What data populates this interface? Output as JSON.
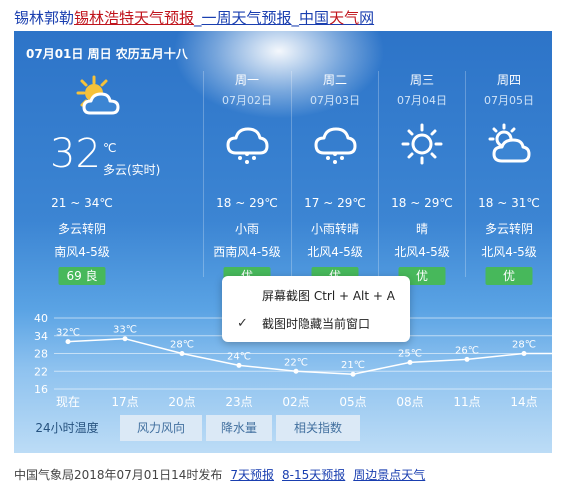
{
  "title": {
    "part1": "锡林郭勒",
    "part2": "锡林浩特天气预报",
    "sep1": "_",
    "part3": "一周天气预报",
    "sep2": "_",
    "part4a": "中国",
    "part4b": "天气",
    "part4c": "网"
  },
  "today": {
    "date_line": "07月01日 周日 农历五月十八",
    "temp": "32",
    "unit": "℃",
    "desc": "多云(实时)",
    "range": "21 ~ 34℃",
    "weather": "多云转阴",
    "wind": "南风4-5级",
    "aqi_label": "69  良",
    "icon": "partly-cloudy-day-icon"
  },
  "forecast": [
    {
      "day": "周一",
      "date": "07月02日",
      "range": "18 ~ 29℃",
      "weather": "小雨",
      "wind": "西南风4-5级",
      "aqi": "优",
      "icon": "rain-cloud-icon"
    },
    {
      "day": "周二",
      "date": "07月03日",
      "range": "17 ~ 29℃",
      "weather": "小雨转晴",
      "wind": "北风4-5级",
      "aqi": "优",
      "icon": "rain-cloud-icon"
    },
    {
      "day": "周三",
      "date": "07月04日",
      "range": "18 ~ 29℃",
      "weather": "晴",
      "wind": "北风4-5级",
      "aqi": "优",
      "icon": "sun-icon"
    },
    {
      "day": "周四",
      "date": "07月05日",
      "range": "18 ~ 31℃",
      "weather": "多云转阴",
      "wind": "北风4-5级",
      "aqi": "优",
      "icon": "partly-cloudy-day-icon"
    }
  ],
  "colors": {
    "aqi_good": "#47b85b",
    "chart_line": "#ffffff"
  },
  "chart_data": {
    "type": "line",
    "categories": [
      "现在",
      "17点",
      "20点",
      "23点",
      "02点",
      "05点",
      "08点",
      "11点",
      "14点"
    ],
    "values": [
      32,
      33,
      28,
      24,
      22,
      21,
      25,
      26,
      28
    ],
    "value_labels": [
      "32℃",
      "33℃",
      "28℃",
      "24℃",
      "22℃",
      "21℃",
      "25℃",
      "26℃",
      "28℃"
    ],
    "yticks": [
      "40",
      "34",
      "28",
      "22",
      "16"
    ],
    "ylim": [
      16,
      40
    ],
    "grid": true
  },
  "tabs": [
    "24小时温度",
    "风力风向",
    "降水量",
    "相关指数"
  ],
  "context_menu": {
    "item1": "屏幕截图 Ctrl + Alt + A",
    "item2_check": "✓",
    "item2": "截图时隐藏当前窗口"
  },
  "footer": {
    "publish": "中国气象局2018年07月01日14时发布",
    "link1": "7天预报",
    "link2": "8-15天预报",
    "link3": "周边景点天气"
  }
}
